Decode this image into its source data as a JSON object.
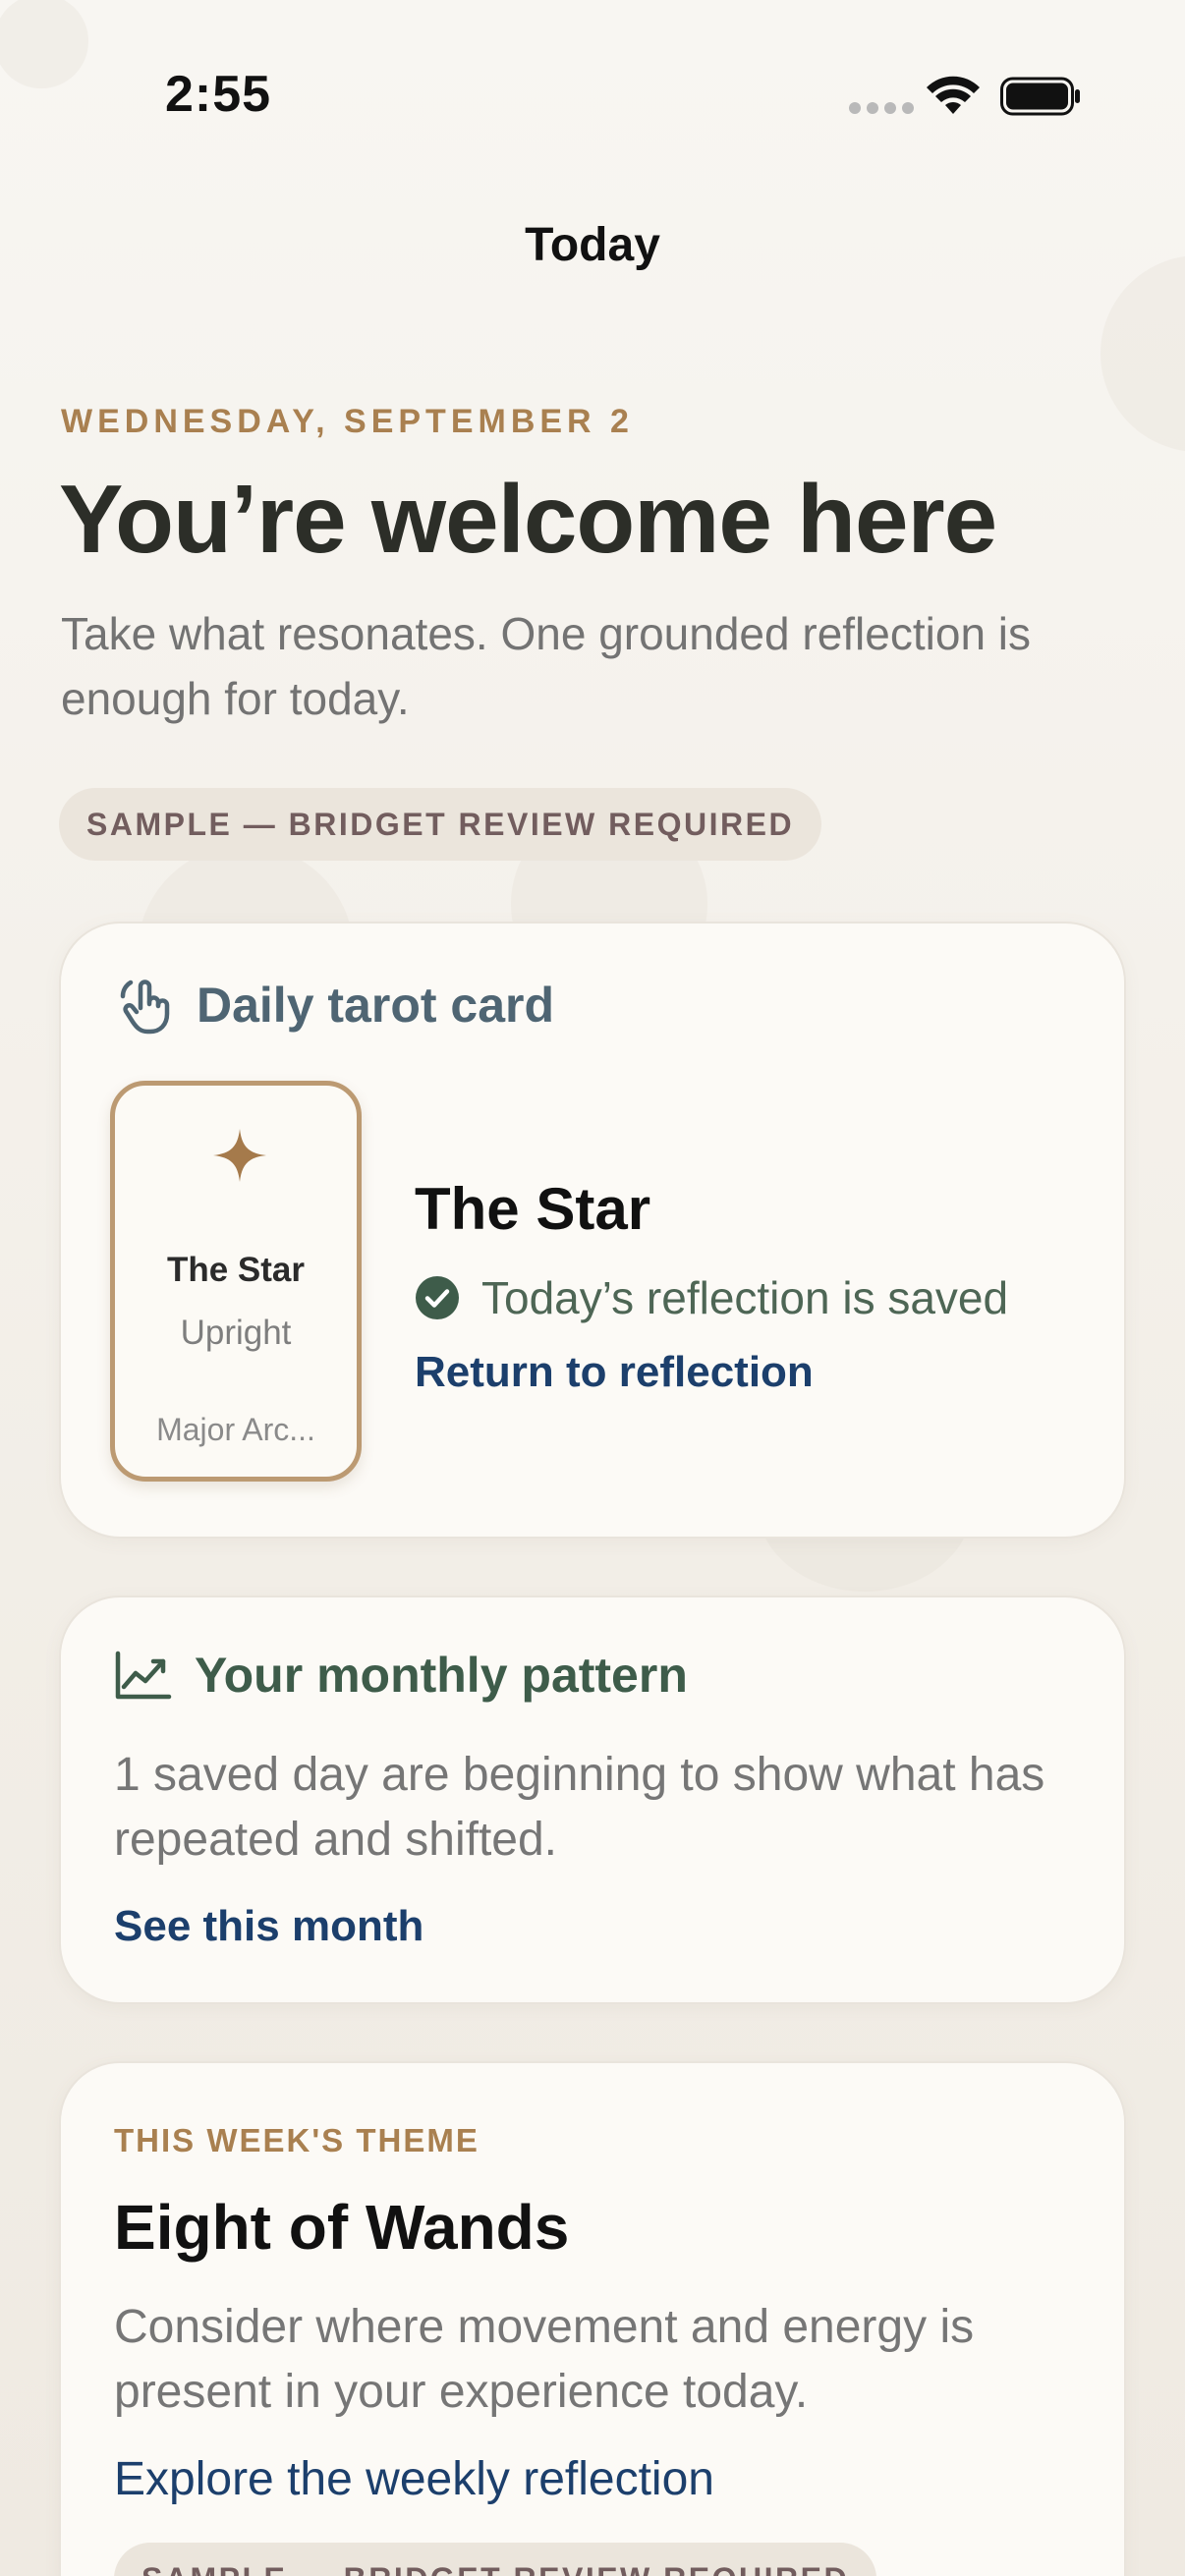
{
  "status_bar": {
    "time": "2:55"
  },
  "nav": {
    "title": "Today"
  },
  "greeting": {
    "date": "WEDNESDAY, SEPTEMBER 2",
    "headline": "You’re welcome here",
    "subtitle": "Take what resonates. One grounded reflection is enough for today."
  },
  "sample_badge": "SAMPLE — BRIDGET REVIEW REQUIRED",
  "daily_card": {
    "header": "Daily tarot card",
    "header_icon": "hand-tap-icon",
    "tarot": {
      "name": "The Star",
      "orientation": "Upright",
      "arcana": "Major Arc..."
    },
    "title": "The Star",
    "status": "Today’s reflection is saved",
    "link": "Return to reflection"
  },
  "monthly_card": {
    "header": "Your monthly pattern",
    "header_icon": "chart-line-icon",
    "body": "1 saved day are beginning to show what has repeated and shifted.",
    "link": "See this month"
  },
  "weekly_card": {
    "label": "THIS WEEK'S THEME",
    "title": "Eight of Wands",
    "body": "Consider where movement and energy is present in your experience today.",
    "link": "Explore the weekly reflection",
    "badge": "SAMPLE — BRIDGET REVIEW REQUIRED"
  },
  "colors": {
    "accent_gold": "#a98050",
    "link_blue": "#1c3f6c",
    "slate": "#4f6573",
    "sage": "#3e5c4a",
    "badge_text": "#725d5e"
  }
}
